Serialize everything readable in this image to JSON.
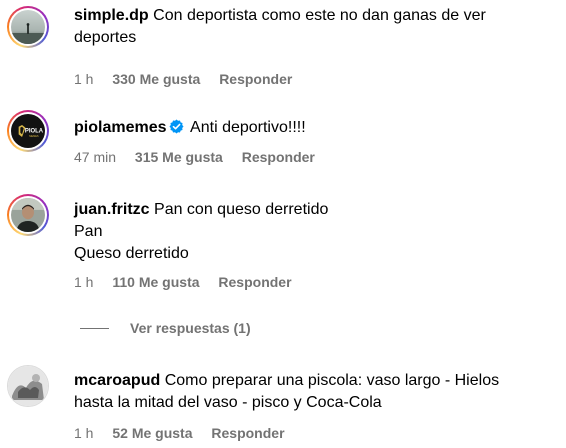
{
  "colors": {
    "text": "#000000",
    "meta": "#737373",
    "verified": "#0095f6",
    "background": "#ffffff"
  },
  "comments": [
    {
      "username": "simple.dp",
      "lines": [
        "Con deportista como este no dan ganas de ver",
        "deportes"
      ],
      "time": "1 h",
      "likes": "330 Me gusta",
      "reply": "Responder",
      "avatar_ring": "story"
    },
    {
      "username": "piolamemes",
      "verified": true,
      "lines": [
        "Anti deportivo!!!!"
      ],
      "time": "47 min",
      "likes": "315 Me gusta",
      "reply": "Responder",
      "avatar_ring": "story",
      "avatar_logo": "PIOLA"
    },
    {
      "username": "juan.fritzc",
      "lines": [
        "Pan con queso derretido",
        "Pan",
        "Queso derretido"
      ],
      "time": "1 h",
      "likes": "110 Me gusta",
      "reply": "Responder",
      "avatar_ring": "story"
    },
    {
      "username": "mcaroapud",
      "lines": [
        "Como preparar una piscola: vaso largo - Hielos",
        "hasta la mitad del vaso - pisco y Coca-Cola"
      ],
      "time": "1 h",
      "likes": "52 Me gusta",
      "reply": "Responder",
      "avatar_ring": "none"
    }
  ],
  "view_replies": "Ver respuestas (1)"
}
